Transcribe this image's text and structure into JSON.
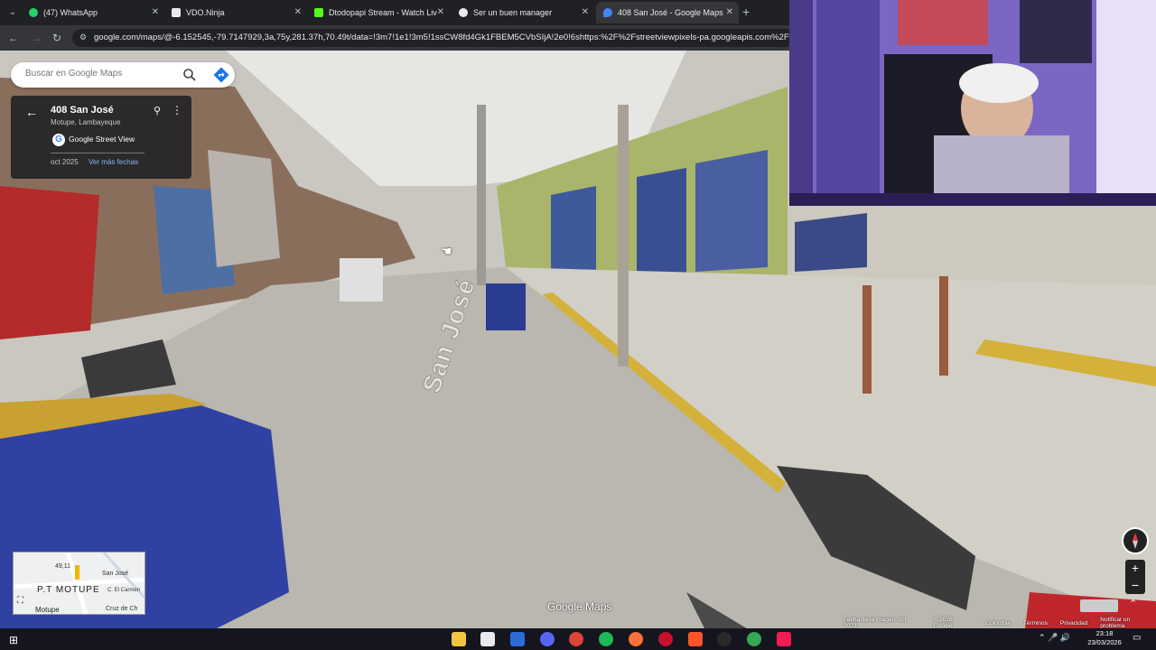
{
  "browser": {
    "tabs": [
      {
        "title": "(47) WhatsApp",
        "color": "#25d366"
      },
      {
        "title": "VDO.Ninja",
        "color": "#e8eaed"
      },
      {
        "title": "Dtodopapi Stream - Watch Live",
        "color": "#53fc18"
      },
      {
        "title": "Ser un buen manager",
        "color": "#e8eaed"
      },
      {
        "title": "408 San José - Google Maps",
        "color": "#4285f4"
      }
    ],
    "url": "google.com/maps/@-6.152545,-79.7147929,3a,75y,281.37h,70.49t/data=!3m7!1e1!3m5!1ssCW8fd4Gk1FBEM5CVbSIjA!2e0!6shttps:%2F%2Fstreetviewpixels-pa.googleapis.com%2Fv1%2Fth"
  },
  "maps": {
    "search_placeholder": "Buscar en Google Maps",
    "place_title": "408 San José",
    "place_subtitle": "Motupe, Lambayeque",
    "source_label": "Google Street View",
    "capture_date": "oct 2025",
    "more_dates_label": "Ver más fechas",
    "road_label": "San José",
    "minimap": {
      "labels": [
        "49,11",
        "San José",
        "P.T MOTUPE",
        "C. El Carmen",
        "Motupe",
        "Cruz de Ch"
      ]
    },
    "watermark": "Google Maps",
    "footer": [
      "Fecha de la imagen: oct 2023",
      "© 2026 Google",
      "Colombia",
      "Términos",
      "Privacidad",
      "Notificar un problema"
    ]
  },
  "taskbar": {
    "time": "23:18",
    "date": "23/03/2026"
  }
}
